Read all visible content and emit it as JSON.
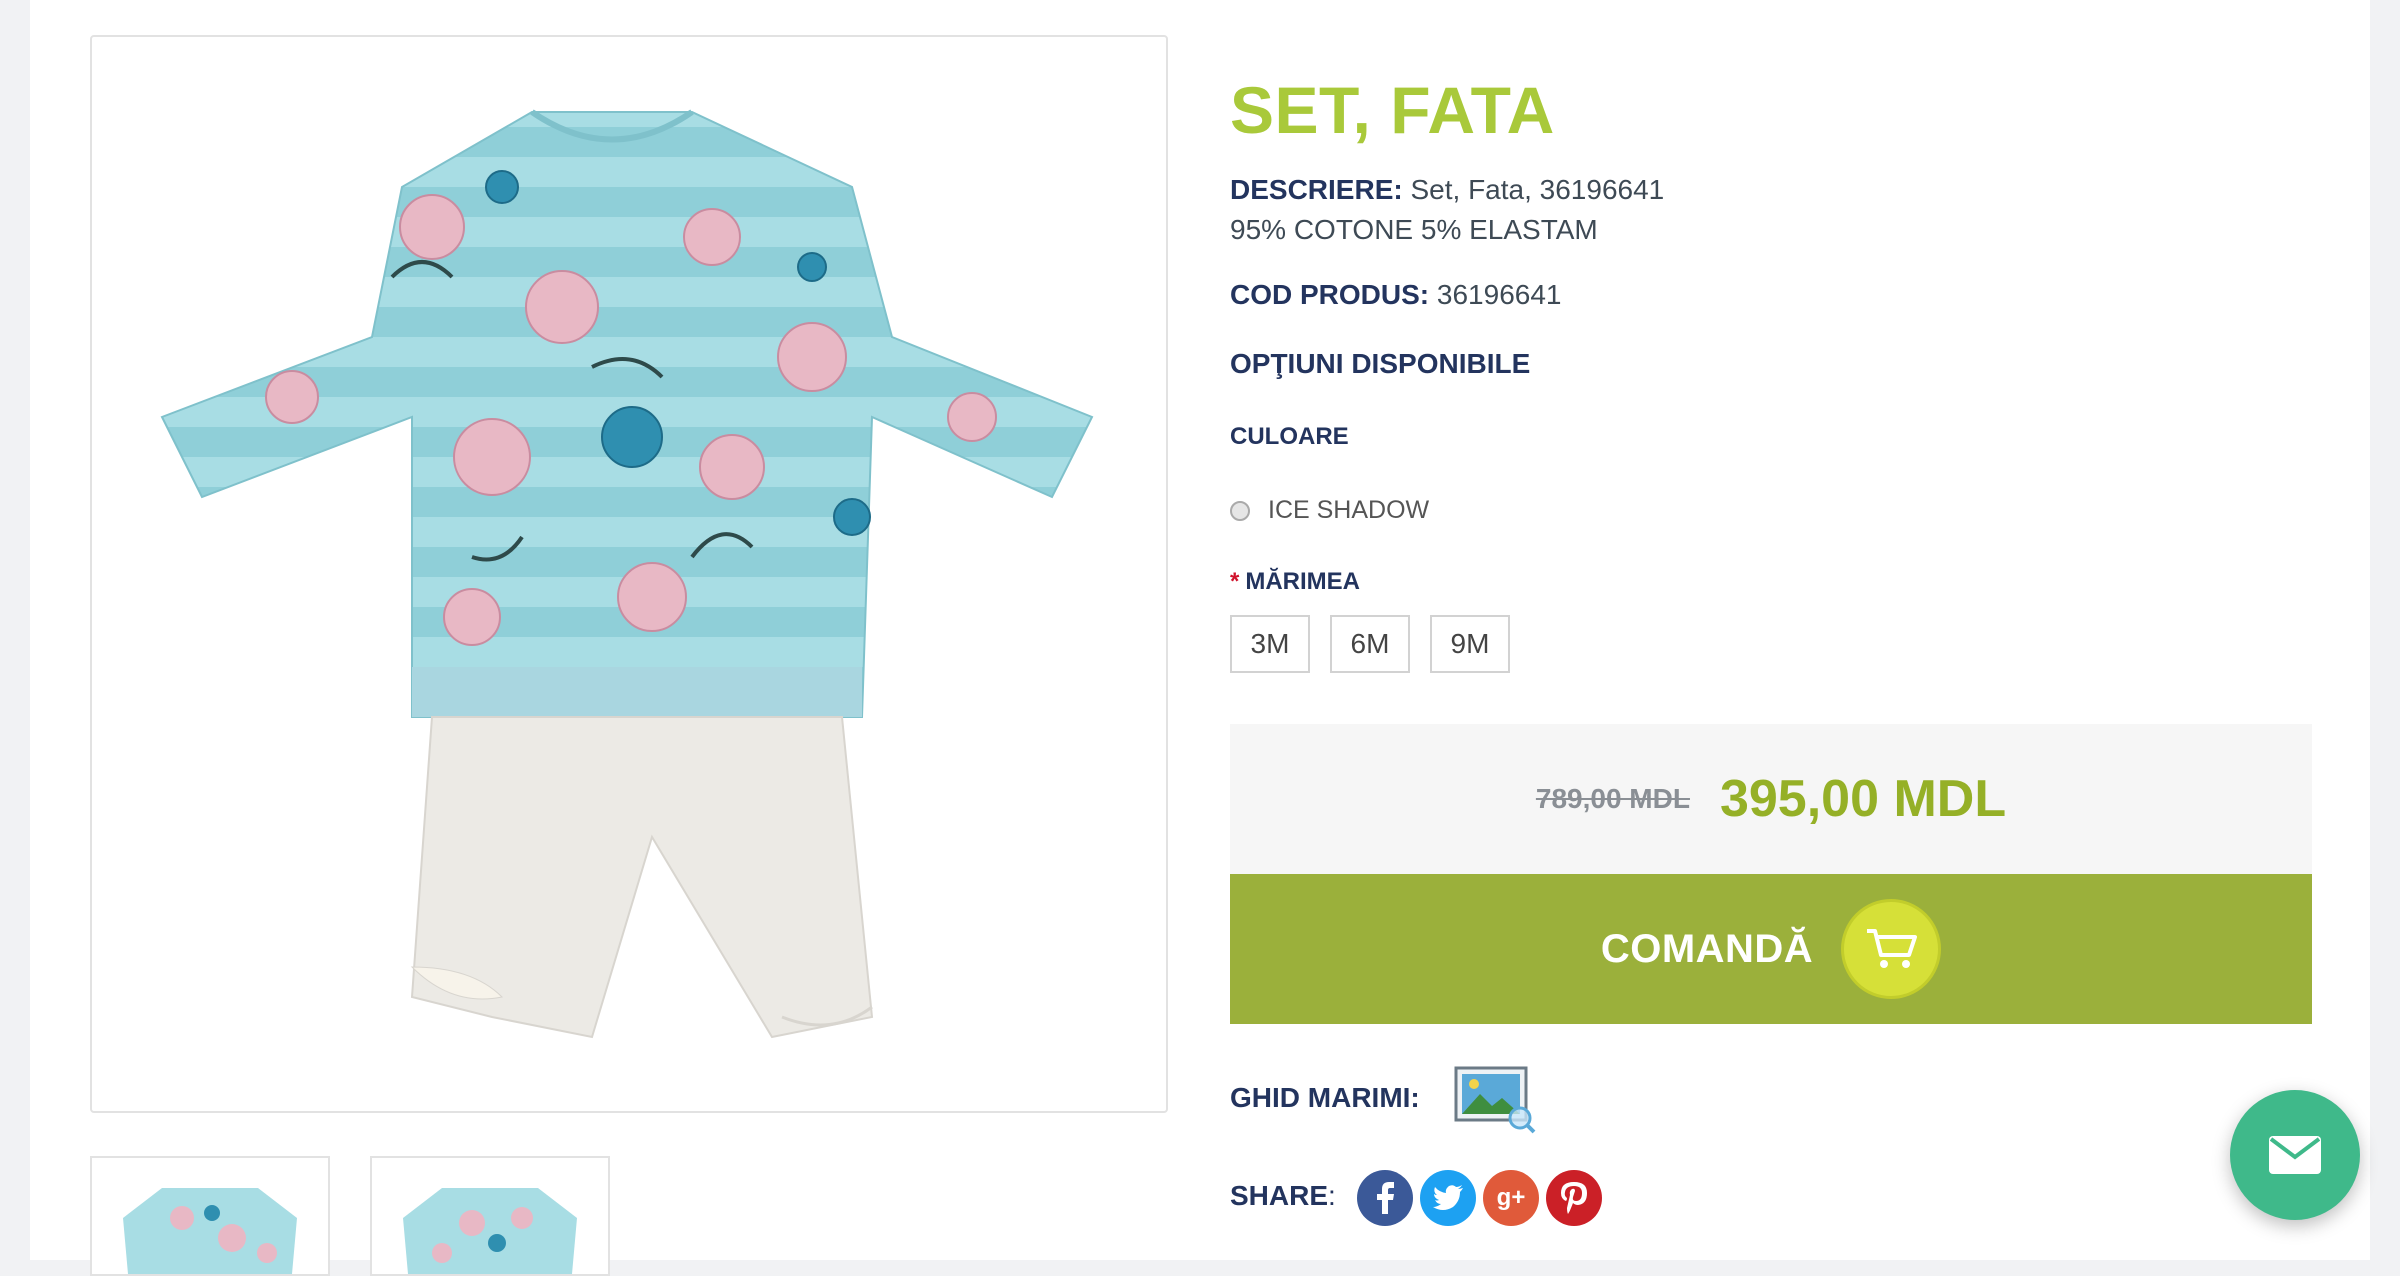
{
  "product": {
    "title": "SET, FATA",
    "description_label": "DESCRIERE:",
    "description_value": "Set, Fata, 36196641",
    "composition": "95% COTONE 5% ELASTAM",
    "code_label": "COD PRODUS:",
    "code_value": "36196641",
    "options_heading": "OPŢIUNI DISPONIBILE",
    "color_label": "CULOARE",
    "color_option": "ICE SHADOW",
    "size_required": "*",
    "size_label": "MĂRIMEA",
    "sizes": [
      "3M",
      "6M",
      "9M"
    ],
    "old_price": "789,00 MDL",
    "new_price": "395,00 MDL",
    "order_label": "COMANDĂ",
    "size_guide_label": "GHID MARIMI:",
    "share_label": "SHARE",
    "share_colon": ":"
  },
  "colors": {
    "title": "#a9c93a",
    "label": "#23345e",
    "order_bg": "#9bb03b",
    "price": "#95b027",
    "facebook": "#3b5998",
    "twitter": "#1da1f2",
    "google_plus": "#e05a3a",
    "pinterest": "#cb2027",
    "chat": "#3fb98a"
  },
  "icons": [
    "cart-icon",
    "image-search-icon",
    "facebook-icon",
    "twitter-icon",
    "google-plus-icon",
    "pinterest-icon",
    "mail-icon"
  ]
}
